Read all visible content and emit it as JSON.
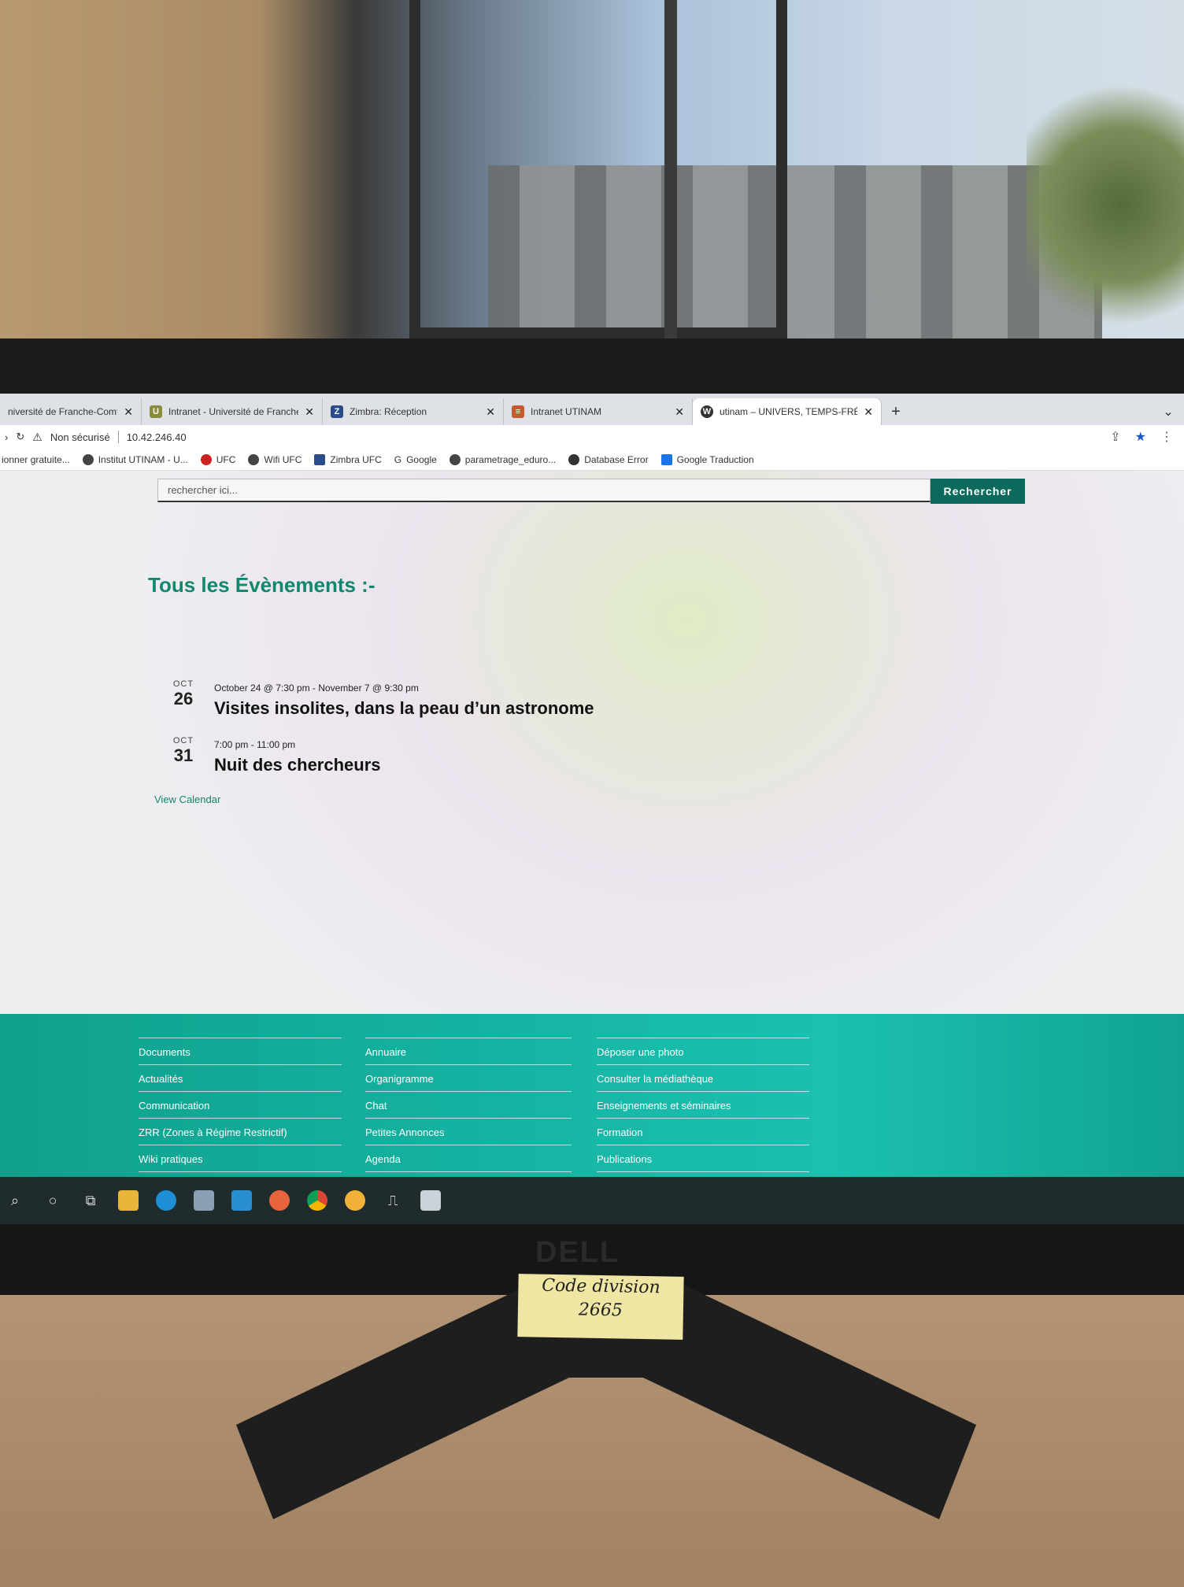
{
  "browser": {
    "tabs": [
      {
        "title": "niversité de Franche-Comté |",
        "icon": "globe-icon"
      },
      {
        "title": "Intranet - Université de Franche-",
        "icon": "u-icon"
      },
      {
        "title": "Zimbra: Réception",
        "icon": "z-icon"
      },
      {
        "title": "Intranet UTINAM",
        "icon": "list-icon"
      },
      {
        "title": "utinam – UNIVERS, TEMPS-FRÉQ",
        "icon": "wordpress-icon",
        "active": true
      }
    ],
    "security_label": "Non sécurisé",
    "url": "10.42.246.40",
    "bookmarks": [
      "ionner gratuite...",
      "Institut UTINAM - U...",
      "UFC",
      "Wifi UFC",
      "Zimbra UFC",
      "Google",
      "parametrage_eduro...",
      "Database Error",
      "Google Traduction"
    ]
  },
  "search": {
    "placeholder": "rechercher ici...",
    "button": "Rechercher"
  },
  "page_title": "Tous les Évènements :-",
  "events": [
    {
      "month": "OCT",
      "day": "26",
      "time": "October 24 @ 7:30 pm - November 7 @ 9:30 pm",
      "name": "Visites insolites, dans la peau d’un astronome"
    },
    {
      "month": "OCT",
      "day": "31",
      "time": "7:00 pm - 11:00 pm",
      "name": "Nuit des chercheurs"
    }
  ],
  "view_calendar": "View Calendar",
  "footer": {
    "col1": [
      "Documents",
      "Actualités",
      "Communication",
      "ZRR (Zones à Régime Restrictif)",
      "Wiki pratiques"
    ],
    "col2": [
      "Annuaire",
      "Organigramme",
      "Chat",
      "Petites Annonces",
      "Agenda"
    ],
    "col3": [
      "Déposer une photo",
      "Consulter la médiathèque",
      "Enseignements et séminaires",
      "Formation",
      "Publications"
    ]
  },
  "monitor_brand": "DELL",
  "sticky_note": {
    "line1": "Code division",
    "line2": "2665"
  }
}
